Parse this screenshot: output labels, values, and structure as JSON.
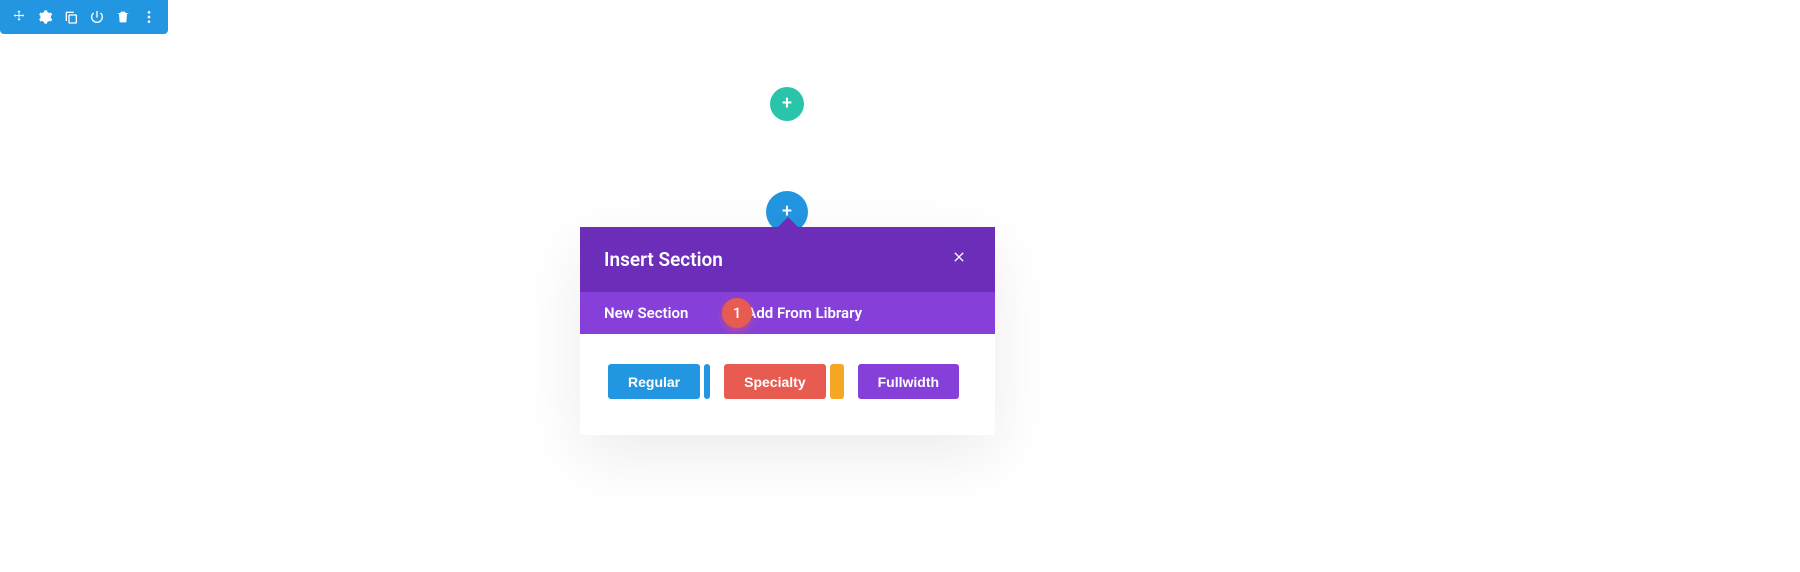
{
  "toolbar": {
    "icons": [
      "move",
      "settings",
      "duplicate",
      "power",
      "delete",
      "more"
    ]
  },
  "add_buttons": {
    "green_plus": "+",
    "blue_plus": "+"
  },
  "modal": {
    "title": "Insert Section",
    "close": "×",
    "tabs": {
      "new": "New Section",
      "library": "Add From Library",
      "badge": "1"
    },
    "section_types": {
      "regular": "Regular",
      "specialty": "Specialty",
      "fullwidth": "Fullwidth"
    }
  },
  "colors": {
    "blue": "#2396e2",
    "teal": "#29c4a9",
    "purple_dark": "#6c2eb9",
    "purple_light": "#8640d9",
    "red": "#e85b51",
    "orange": "#f5a623"
  }
}
